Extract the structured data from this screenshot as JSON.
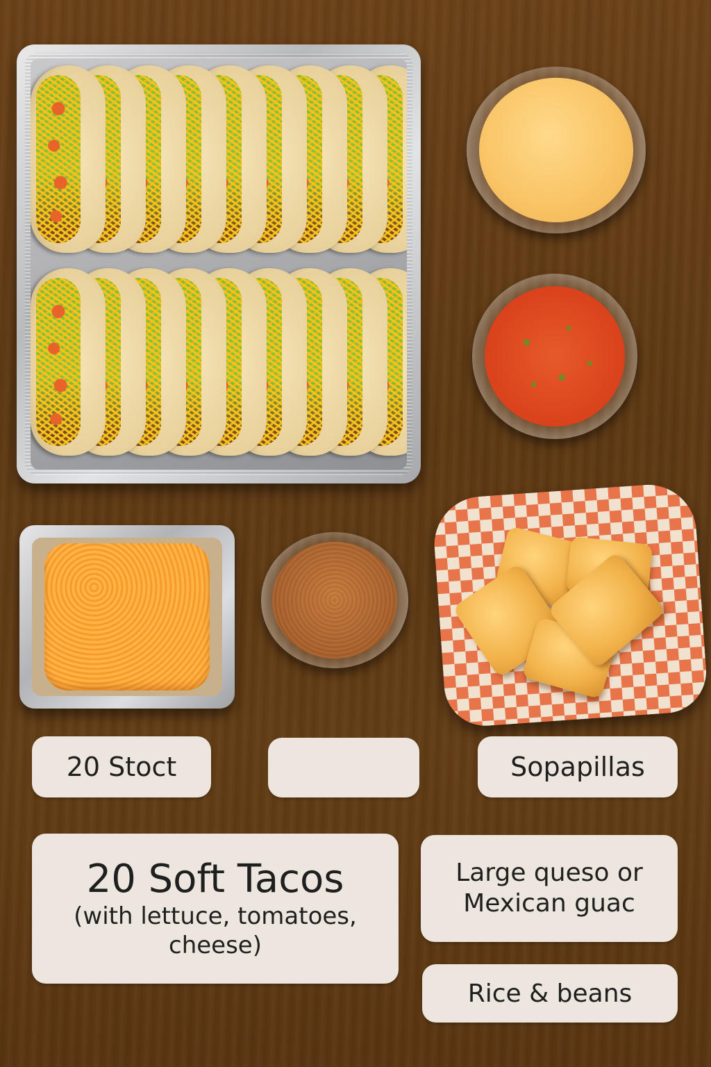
{
  "labels": {
    "stoct": "20 Stoct",
    "blank": "",
    "sopapillas": "Sopapillas",
    "tacos_title": "20 Soft Tacos",
    "tacos_detail": "(with lettuce, tomatoes, cheese)",
    "queso_line1": "Large queso or",
    "queso_line2": "Mexican guac",
    "rice_beans": "Rice & beans"
  },
  "colors": {
    "background": "#5e3914",
    "label_bg": "#ece6de",
    "label_text": "#1f1f1f",
    "queso": "#f9c567",
    "salsa": "#d9421c",
    "beans": "#a85f2b",
    "cheese": "#f8a33a",
    "basket_check": "#e8744a"
  }
}
